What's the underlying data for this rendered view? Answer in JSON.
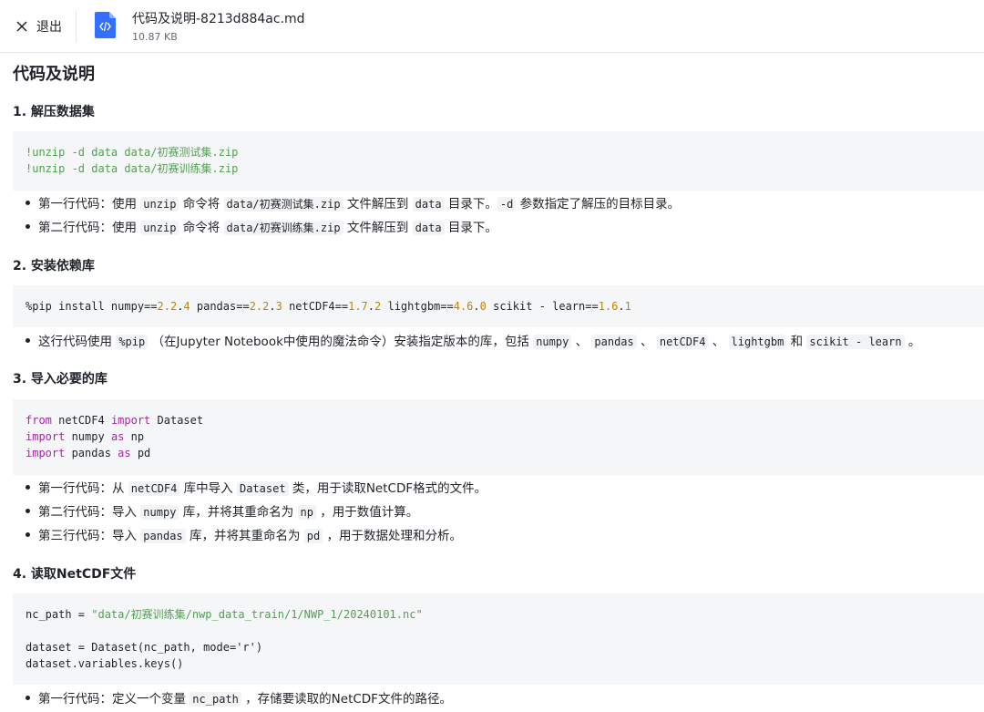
{
  "topbar": {
    "exit_label": "退出",
    "file_name": "代码及说明-8213d884ac.md",
    "file_size": "10.87 KB"
  },
  "doc": {
    "title": "代码及说明",
    "sections": [
      {
        "heading": "1. 解压数据集"
      },
      {
        "heading": "2. 安装依赖库"
      },
      {
        "heading": "3. 导入必要的库"
      },
      {
        "heading": "4. 读取NetCDF文件"
      }
    ],
    "s1": {
      "code": [
        "!unzip -d data data/初赛测试集.zip",
        "!unzip -d data data/初赛训练集.zip"
      ],
      "b1": {
        "a": "第一行代码：使用 ",
        "c1": "unzip",
        "b": " 命令将 ",
        "c2": "data/初赛测试集.zip",
        "c": " 文件解压到 ",
        "c3": "data",
        "d": " 目录下。",
        "c4": "-d",
        "e": " 参数指定了解压的目标目录。"
      },
      "b2": {
        "a": "第二行代码：使用 ",
        "c1": "unzip",
        "b": " 命令将 ",
        "c2": "data/初赛训练集.zip",
        "c": " 文件解压到 ",
        "c3": "data",
        "d": " 目录下。"
      }
    },
    "s2": {
      "code": {
        "p0": "%pip install numpy==",
        "v1": "2.2",
        "p1": ".",
        "v2": "4",
        "p2": " pandas==",
        "v3": "2.2",
        "p3": ".",
        "v4": "3",
        "p4": " netCDF4==",
        "v5": "1.7",
        "p5": ".",
        "v6": "2",
        "p6": " lightgbm==",
        "v7": "4.6",
        "p7": ".",
        "v8": "0",
        "p8": " scikit - learn==",
        "v9": "1.6",
        "p9": ".",
        "v10": "1"
      },
      "b1": {
        "a": "这行代码使用 ",
        "c1": "%pip",
        "b": " （在Jupyter Notebook中使用的魔法命令）安装指定版本的库，包括 ",
        "c2": "numpy",
        "s1": " 、 ",
        "c3": "pandas",
        "s2": " 、 ",
        "c4": "netCDF4",
        "s3": " 、 ",
        "c5": "lightgbm",
        "s4": " 和 ",
        "c6": "scikit - learn",
        "e": " 。"
      }
    },
    "s3": {
      "code": {
        "l1_kw1": "from",
        "l1_t1": " netCDF4 ",
        "l1_kw2": "import",
        "l1_t2": " Dataset",
        "l2_kw1": "import",
        "l2_t1": " numpy ",
        "l2_kw2": "as",
        "l2_t2": " np",
        "l3_kw1": "import",
        "l3_t1": " pandas ",
        "l3_kw2": "as",
        "l3_t2": " pd"
      },
      "b1": {
        "a": "第一行代码：从 ",
        "c1": "netCDF4",
        "b": " 库中导入 ",
        "c2": "Dataset",
        "c": " 类，用于读取NetCDF格式的文件。"
      },
      "b2": {
        "a": "第二行代码：导入 ",
        "c1": "numpy",
        "b": " 库，并将其重命名为 ",
        "c2": "np",
        "c": " ，用于数值计算。"
      },
      "b3": {
        "a": "第三行代码：导入 ",
        "c1": "pandas",
        "b": " 库，并将其重命名为 ",
        "c2": "pd",
        "c": " ，用于数据处理和分析。"
      }
    },
    "s4": {
      "code": {
        "l1_a": "nc_path = ",
        "l1_str": "\"data/初赛训练集/nwp_data_train/1/NWP_1/20240101.nc\"",
        "l3": "dataset = Dataset(nc_path, mode='r')",
        "l4": "dataset.variables.keys()"
      },
      "b1": {
        "a": "第一行代码：定义一个变量 ",
        "c1": "nc_path",
        "b": " ，存储要读取的NetCDF文件的路径。"
      }
    }
  }
}
